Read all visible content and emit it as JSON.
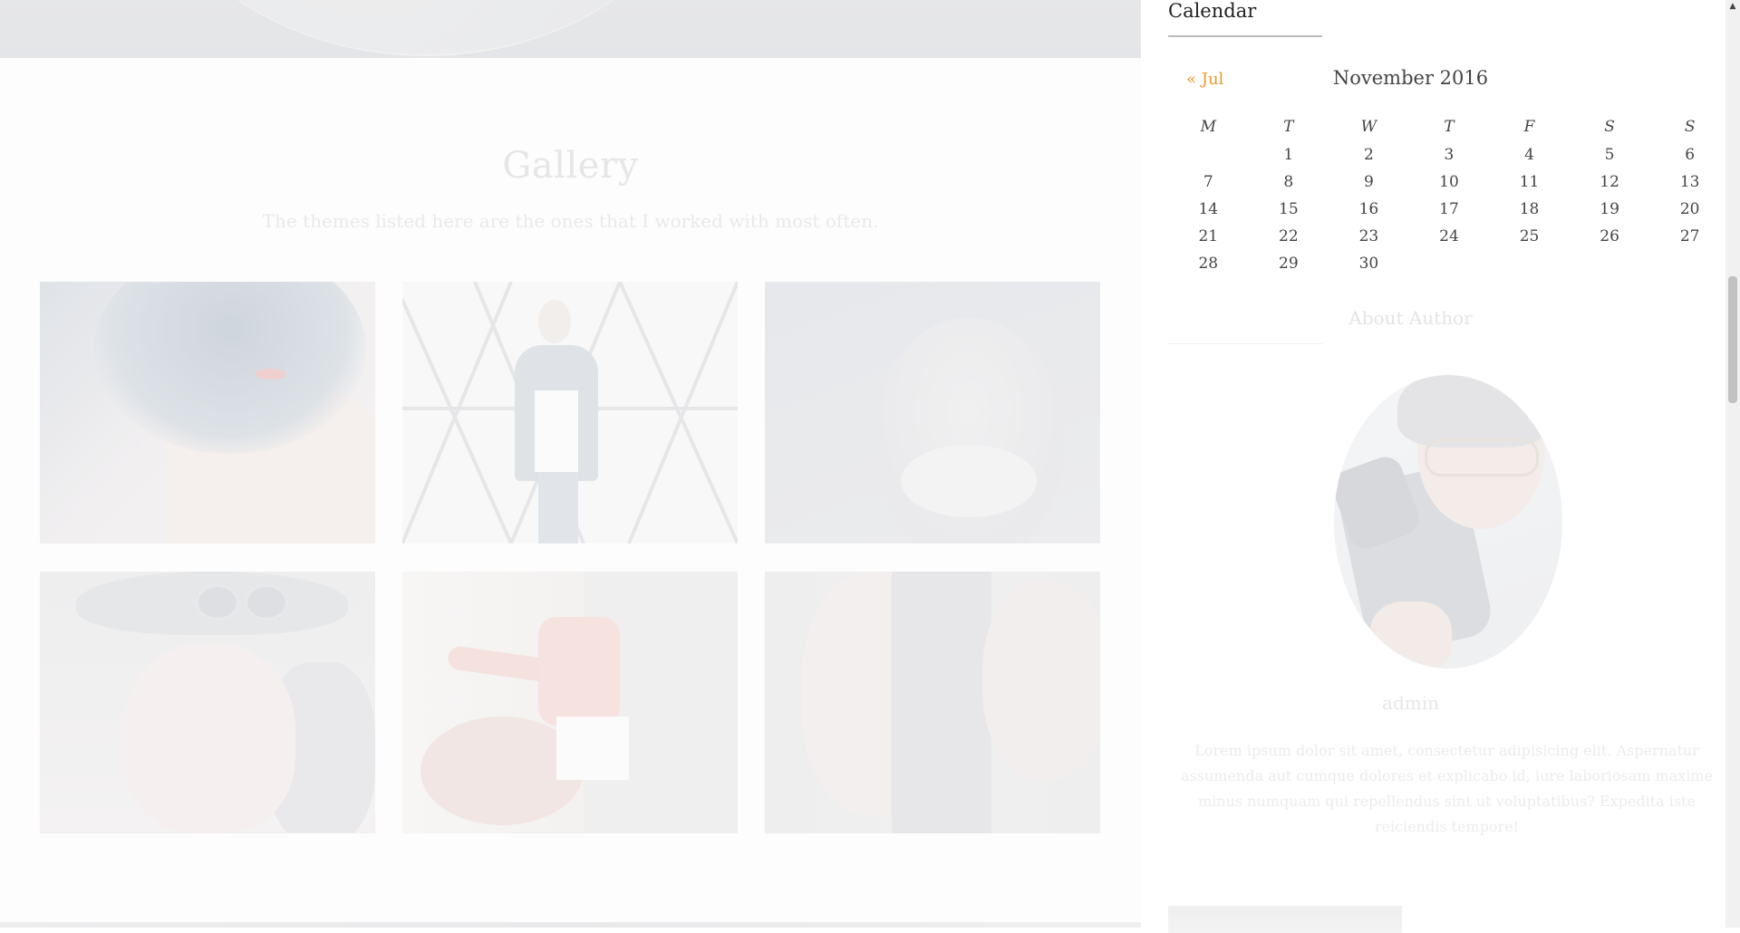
{
  "gallery": {
    "title": "Gallery",
    "subtitle": "The themes listed here are the ones that I worked with most often."
  },
  "calendar": {
    "title": "Calendar",
    "prev_link": "« Jul",
    "caption": "November 2016",
    "weekdays": [
      "M",
      "T",
      "W",
      "T",
      "F",
      "S",
      "S"
    ],
    "weeks": [
      [
        "",
        "1",
        "2",
        "3",
        "4",
        "5",
        "6"
      ],
      [
        "7",
        "8",
        "9",
        "10",
        "11",
        "12",
        "13"
      ],
      [
        "14",
        "15",
        "16",
        "17",
        "18",
        "19",
        "20"
      ],
      [
        "21",
        "22",
        "23",
        "24",
        "25",
        "26",
        "27"
      ],
      [
        "28",
        "29",
        "30",
        "",
        "",
        "",
        ""
      ]
    ]
  },
  "about": {
    "title": "About Author",
    "name": "admin",
    "bio": "Lorem ipsum dolor sit amet, consectetur adipisicing elit. Aspernatur assumenda aut cumque dolores et explicabo id, iure laboriosam maxime minus numquam qui repellendus sint ut voluptatibus? Expedita iste reiciendis tempore!"
  },
  "colors": {
    "accent_link": "#e89a2c"
  }
}
